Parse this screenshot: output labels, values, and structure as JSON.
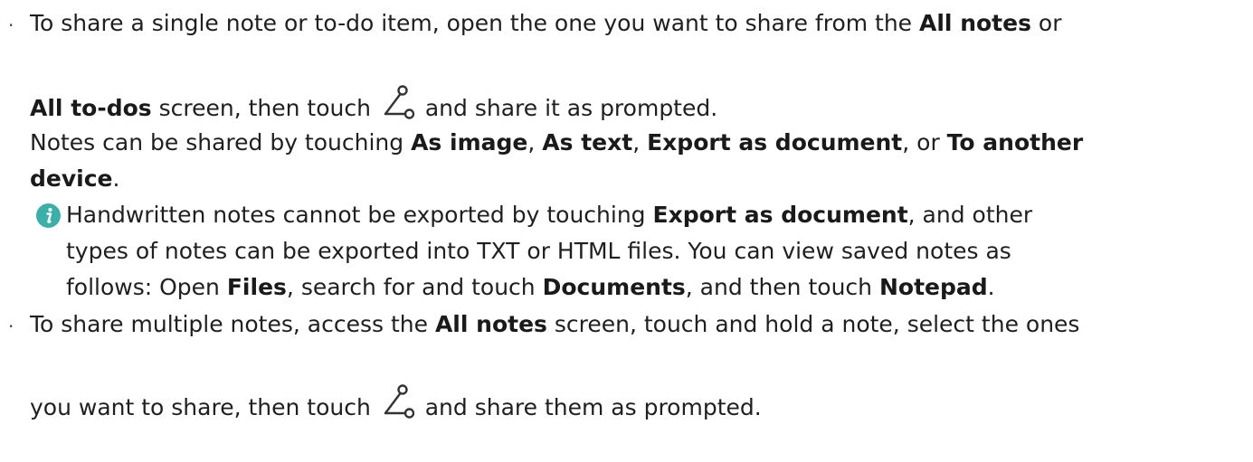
{
  "bullet_char": "·",
  "item1": {
    "line1": {
      "t1": "To share a single note or to-do item, open the one you want to share from the ",
      "b1": "All notes",
      "t2": " or"
    },
    "line2": {
      "b1": "All to-dos",
      "t1": " screen, then touch ",
      "t2": " and share it as prompted."
    },
    "line3": {
      "t1": "Notes can be shared by touching ",
      "b1": "As image",
      "t2": ", ",
      "b2": "As text",
      "t3": ", ",
      "b3": "Export as document",
      "t4": ", or ",
      "b4": "To another"
    },
    "line4": {
      "b1": "device",
      "t1": "."
    }
  },
  "note": {
    "icon": "info-icon",
    "line1": {
      "t1": "Handwritten notes cannot be exported by touching ",
      "b1": "Export as document",
      "t2": ", and other"
    },
    "line2": {
      "t1": "types of notes can be exported into TXT or HTML files. You can view saved notes as"
    },
    "line3": {
      "t1": "follows: Open ",
      "b1": "Files",
      "t2": ", search for and touch ",
      "b2": "Documents",
      "t3": ", and then touch ",
      "b3": "Notepad",
      "t4": "."
    }
  },
  "item2": {
    "line1": {
      "t1": "To share multiple notes, access the ",
      "b1": "All notes",
      "t2": " screen, touch and hold a note, select the ones"
    },
    "line2": {
      "t1": "you want to share, then touch ",
      "t2": " and share them as prompted."
    }
  },
  "colors": {
    "text": "#1f1f1f",
    "info_icon": "#3bb0a8"
  },
  "icons": [
    "share-icon",
    "info-icon"
  ]
}
